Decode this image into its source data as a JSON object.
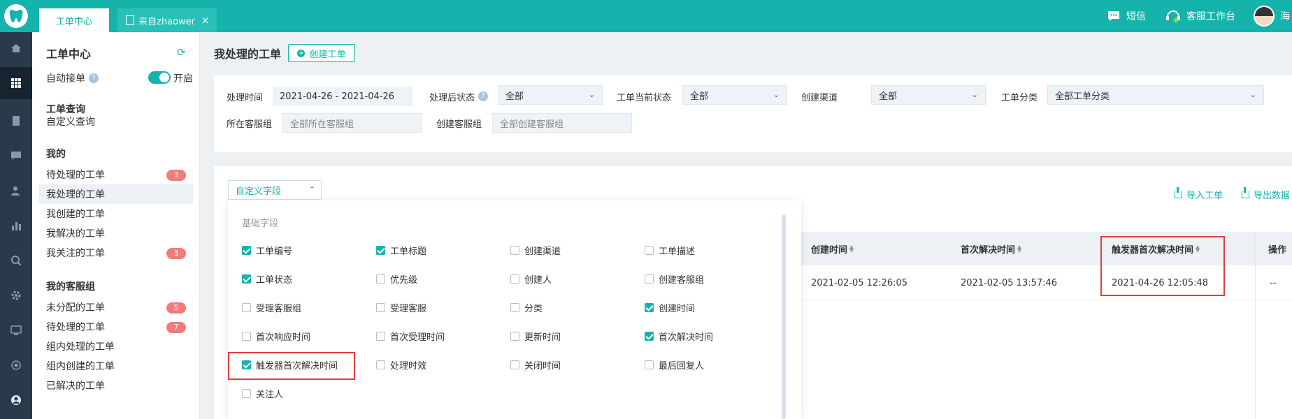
{
  "topbar": {
    "tabs": [
      {
        "label": "工单中心",
        "active": true
      },
      {
        "label": "来自zhaower",
        "close": "×"
      }
    ],
    "sms_label": "短信",
    "workspace_label": "客服工作台",
    "user_name": "海"
  },
  "sidebar": {
    "title": "工单中心",
    "auto_accept_label": "自动接单",
    "toggle_label": "开启",
    "query_head": "工单查询",
    "custom_query": "自定义查询",
    "mine_head": "我的",
    "mine_items": [
      {
        "label": "待处理的工单",
        "badge": "3"
      },
      {
        "label": "我处理的工单"
      },
      {
        "label": "我创建的工单"
      },
      {
        "label": "我解决的工单"
      },
      {
        "label": "我关注的工单",
        "badge": "3"
      }
    ],
    "group_head": "我的客服组",
    "group_items": [
      {
        "label": "未分配的工单",
        "badge": "5"
      },
      {
        "label": "待处理的工单",
        "badge": "7"
      },
      {
        "label": "组内处理的工单"
      },
      {
        "label": "组内创建的工单"
      },
      {
        "label": "已解决的工单"
      }
    ]
  },
  "main": {
    "title": "我处理的工单",
    "create_button": "创建工单",
    "filters": {
      "time_label": "处理时间",
      "time_value": "2021-04-26 - 2021-04-26",
      "after_status_label": "处理后状态",
      "after_status_value": "全部",
      "current_status_label": "工单当前状态",
      "current_status_value": "全部",
      "channel_label": "创建渠道",
      "channel_value": "全部",
      "category_label": "工单分类",
      "category_value": "全部工单分类",
      "group_label": "所在客服组",
      "group_placeholder": "全部所在客服组",
      "create_group_label": "创建客服组",
      "create_group_placeholder": "全部创建客服组"
    },
    "custom_fields_button": "自定义字段",
    "import_label": "导入工单",
    "export_label": "导出数据",
    "field_section": "基础字段",
    "fields": [
      {
        "label": "工单编号",
        "checked": true
      },
      {
        "label": "工单标题",
        "checked": true
      },
      {
        "label": "创建渠道",
        "checked": false
      },
      {
        "label": "工单描述",
        "checked": false
      },
      {
        "label": "工单状态",
        "checked": true
      },
      {
        "label": "优先级",
        "checked": false
      },
      {
        "label": "创建人",
        "checked": false
      },
      {
        "label": "创建客服组",
        "checked": false
      },
      {
        "label": "受理客服组",
        "checked": false
      },
      {
        "label": "受理客服",
        "checked": false
      },
      {
        "label": "分类",
        "checked": false
      },
      {
        "label": "创建时间",
        "checked": true
      },
      {
        "label": "首次响应时间",
        "checked": false
      },
      {
        "label": "首次受理时间",
        "checked": false
      },
      {
        "label": "更新时间",
        "checked": false
      },
      {
        "label": "首次解决时间",
        "checked": true
      },
      {
        "label": "触发器首次解决时间",
        "checked": true
      },
      {
        "label": "处理时效",
        "checked": false
      },
      {
        "label": "关闭时间",
        "checked": false
      },
      {
        "label": "最后回复人",
        "checked": false
      },
      {
        "label": "关注人",
        "checked": false
      }
    ],
    "table": {
      "headers": [
        "创建时间",
        "首次解决时间",
        "触发器首次解决时间",
        "操作"
      ],
      "row": [
        "2021-02-05 12:26:05",
        "2021-02-05 13:57:46",
        "2021-04-26 12:05:48",
        "--"
      ]
    }
  },
  "colors": {
    "brand": "#16b3ac",
    "badge": "#f27b7b",
    "highlight": "#e43b3b",
    "nav_bg": "#2a3a4a"
  }
}
